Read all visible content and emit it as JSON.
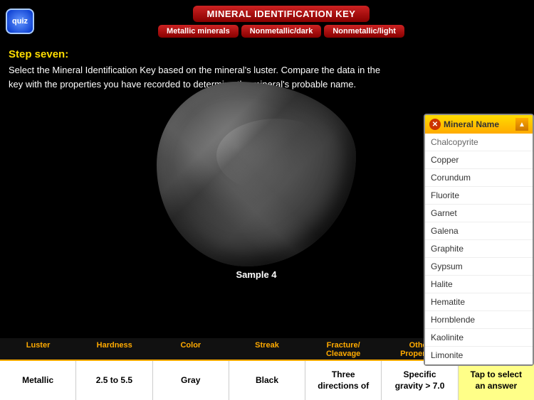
{
  "header": {
    "quiz_label": "quiz",
    "title": "MINERAL IDENTIFICATION KEY",
    "tabs": [
      {
        "id": "metallic",
        "label": "Metallic minerals",
        "active": false
      },
      {
        "id": "nonmetallic-dark",
        "label": "Nonmetallic/dark",
        "active": false
      },
      {
        "id": "nonmetallic-light",
        "label": "Nonmetallic/light",
        "active": false
      }
    ]
  },
  "step": {
    "label": "Step seven:",
    "instructions": "Select the Mineral Identification Key based on the mineral's luster. Compare the data in the key with the properties you have recorded to determine the mineral's probable name."
  },
  "sample": {
    "label": "Sample 4"
  },
  "dropdown": {
    "title": "Mineral Name",
    "items": [
      "Chalcopyrite",
      "Copper",
      "Corundum",
      "Fluorite",
      "Garnet",
      "Galena",
      "Graphite",
      "Gypsum",
      "Halite",
      "Hematite",
      "Hornblende",
      "Kaolinite",
      "Limonite"
    ]
  },
  "table": {
    "headers": [
      "Luster",
      "Hardness",
      "Color",
      "Streak",
      "Fracture/ Cleavage",
      "Other Properties",
      ""
    ],
    "row": [
      "Metallic",
      "2.5 to 5.5",
      "Gray",
      "Black",
      "Three directions of",
      "Specific gravity > 7.0",
      "Tap to select an answer"
    ]
  },
  "icons": {
    "close": "✕",
    "arrow_up": "▲",
    "arrow_down": "▼"
  }
}
